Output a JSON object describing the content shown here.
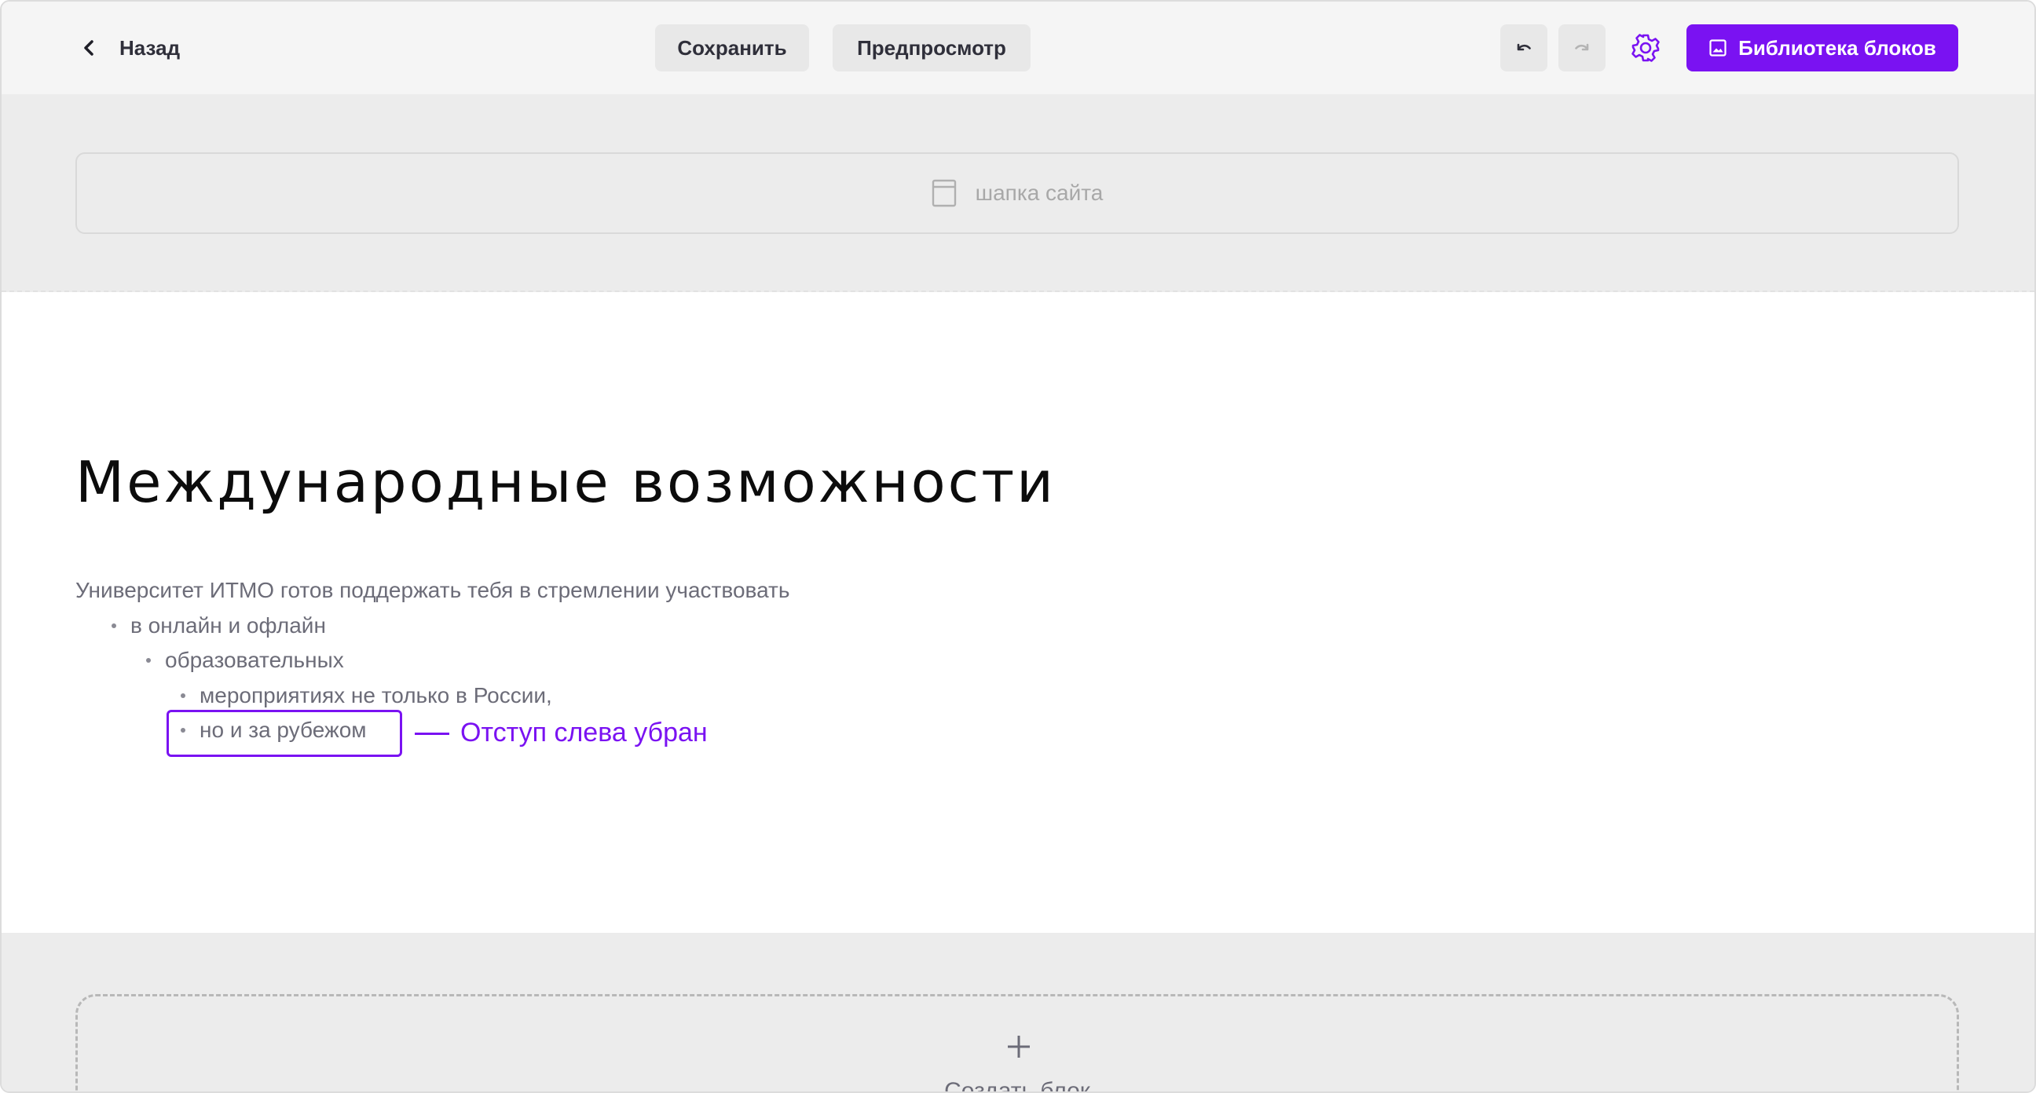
{
  "toolbar": {
    "back_label": "Назад",
    "save_label": "Сохранить",
    "preview_label": "Предпросмотр",
    "library_label": "Библиотека блоков",
    "icons": {
      "back": "chevron-left-icon",
      "undo": "undo-icon",
      "redo": "redo-icon",
      "settings": "gear-icon",
      "library": "image-icon"
    }
  },
  "site_header": {
    "label": "шапка сайта",
    "icon": "page-header-icon"
  },
  "content": {
    "title": "Международные возможности",
    "intro": "Университет ИТМО готов поддержать тебя в стремлении участвовать",
    "list": [
      {
        "text": "в онлайн и офлайн",
        "level": 1
      },
      {
        "text": "образовательных",
        "level": 2
      },
      {
        "text": "мероприятиях не только в России,",
        "level": 3
      },
      {
        "text": "но и за рубежом",
        "level": 3
      }
    ],
    "annotation": "Отступ слева убран"
  },
  "create_block": {
    "label": "Создать блок",
    "icon": "plus-icon"
  },
  "colors": {
    "accent": "#7a12f2",
    "toolbar_bg": "#f5f5f5",
    "zone_bg": "#ececec",
    "text_muted": "#6c6c78",
    "title": "#0c0c0c"
  }
}
